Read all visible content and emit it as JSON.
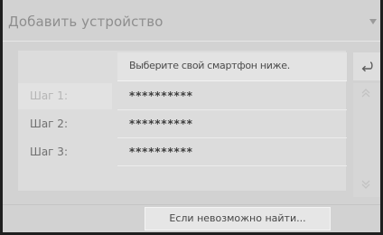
{
  "header": {
    "title": "Добавить устройство"
  },
  "instruction": {
    "text": "Выберите свой смартфон ниже."
  },
  "steps": [
    {
      "label": "Шаг 1:",
      "value": "**********"
    },
    {
      "label": "Шаг 2:",
      "value": "**********"
    },
    {
      "label": "Шаг 3:",
      "value": "**********"
    }
  ],
  "footer": {
    "find_button_label": "Если невозможно найти..."
  },
  "icons": {
    "back": "back-arrow-icon",
    "scroll_up": "double-chevron-up-icon",
    "scroll_down": "double-chevron-down-icon",
    "signal": "signal-icon"
  },
  "colors": {
    "screen_bg": "#d2d2d2",
    "title_text": "#8e8e8e",
    "frame": "#1f1f1f"
  }
}
